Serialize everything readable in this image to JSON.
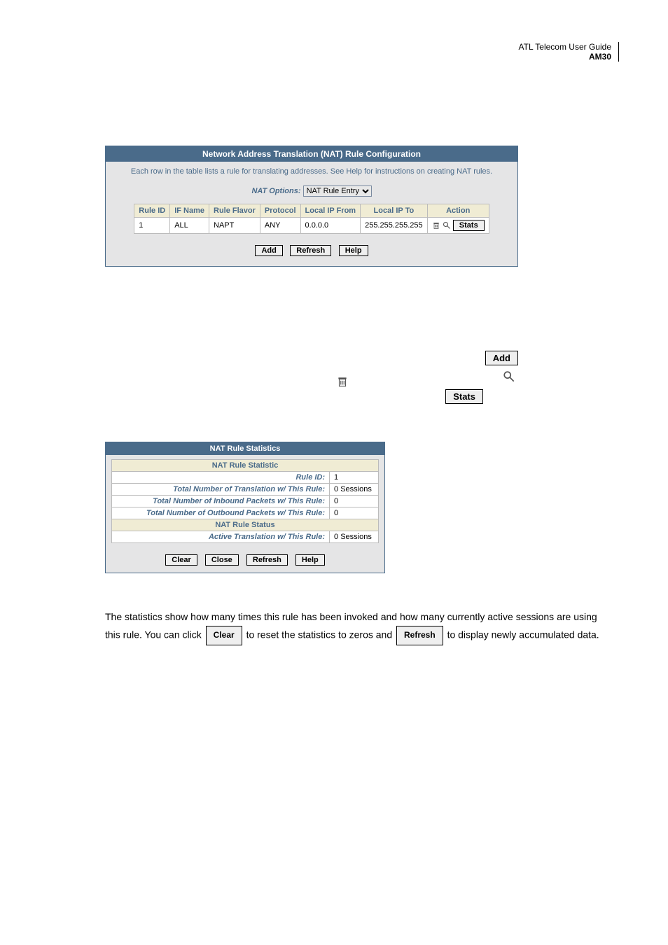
{
  "doc_header": {
    "line1": "ATL Telecom User Guide",
    "line2": "AM30"
  },
  "nat_config": {
    "title": "Network Address Translation (NAT) Rule Configuration",
    "subtitle": "Each row in the table lists a rule for translating addresses. See Help for instructions on creating NAT rules.",
    "options_label": "NAT Options:",
    "options_selected": "NAT Rule Entry",
    "headers": {
      "rule_id": "Rule ID",
      "if_name": "IF Name",
      "rule_flavor": "Rule Flavor",
      "protocol": "Protocol",
      "local_from": "Local IP From",
      "local_to": "Local IP To",
      "action": "Action"
    },
    "row": {
      "rule_id": "1",
      "if_name": "ALL",
      "rule_flavor": "NAPT",
      "protocol": "ANY",
      "local_from": "0.0.0.0",
      "local_to": "255.255.255.255",
      "stats_btn": "Stats"
    },
    "buttons": {
      "add": "Add",
      "refresh": "Refresh",
      "help": "Help"
    }
  },
  "mid": {
    "add": "Add",
    "stats": "Stats"
  },
  "stats_panel": {
    "title": "NAT Rule Statistics",
    "section1": "NAT Rule Statistic",
    "rows": {
      "rule_id_lbl": "Rule ID:",
      "rule_id_val": "1",
      "total_trans_lbl": "Total Number of Translation w/ This Rule:",
      "total_trans_val": "0 Sessions",
      "inbound_lbl": "Total Number of Inbound Packets w/ This Rule:",
      "inbound_val": "0",
      "outbound_lbl": "Total Number of Outbound Packets w/ This Rule:",
      "outbound_val": "0"
    },
    "section2": "NAT Rule Status",
    "rows2": {
      "active_lbl": "Active Translation w/ This Rule:",
      "active_val": "0 Sessions"
    },
    "buttons": {
      "clear": "Clear",
      "close": "Close",
      "refresh": "Refresh",
      "help": "Help"
    }
  },
  "body": {
    "t1": "The statistics show how many times this rule has been invoked and how many currently active sessions are using this rule. You can click ",
    "clear_btn": "Clear",
    "t2": " to reset the statistics to zeros and ",
    "refresh_btn": "Refresh",
    "t3": " to display newly accumulated data."
  }
}
